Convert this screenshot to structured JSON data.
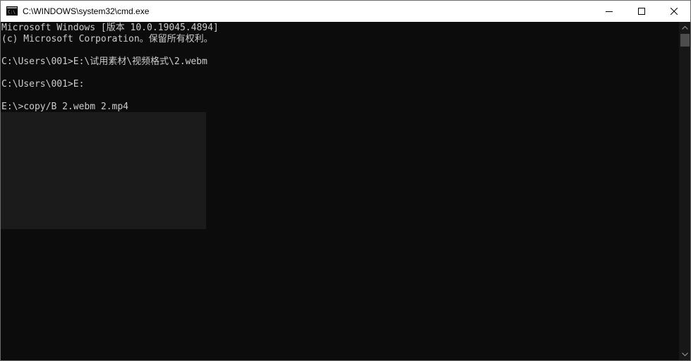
{
  "window": {
    "title": "C:\\WINDOWS\\system32\\cmd.exe",
    "icon": "cmd-icon"
  },
  "caption_buttons": {
    "minimize_icon": "minimize-icon",
    "maximize_icon": "maximize-icon",
    "close_icon": "close-icon"
  },
  "console": {
    "lines": [
      "Microsoft Windows [版本 10.0.19045.4894]",
      "(c) Microsoft Corporation。保留所有权利。",
      "",
      "C:\\Users\\001>E:\\试用素材\\视频格式\\2.webm",
      "",
      "C:\\Users\\001>E:",
      "",
      "E:\\>copy/B 2.webm 2.mp4"
    ]
  },
  "colors": {
    "background": "#0c0c0c",
    "text": "#cccccc",
    "titlebar": "#ffffff",
    "overlay": "#1b1b1b"
  }
}
